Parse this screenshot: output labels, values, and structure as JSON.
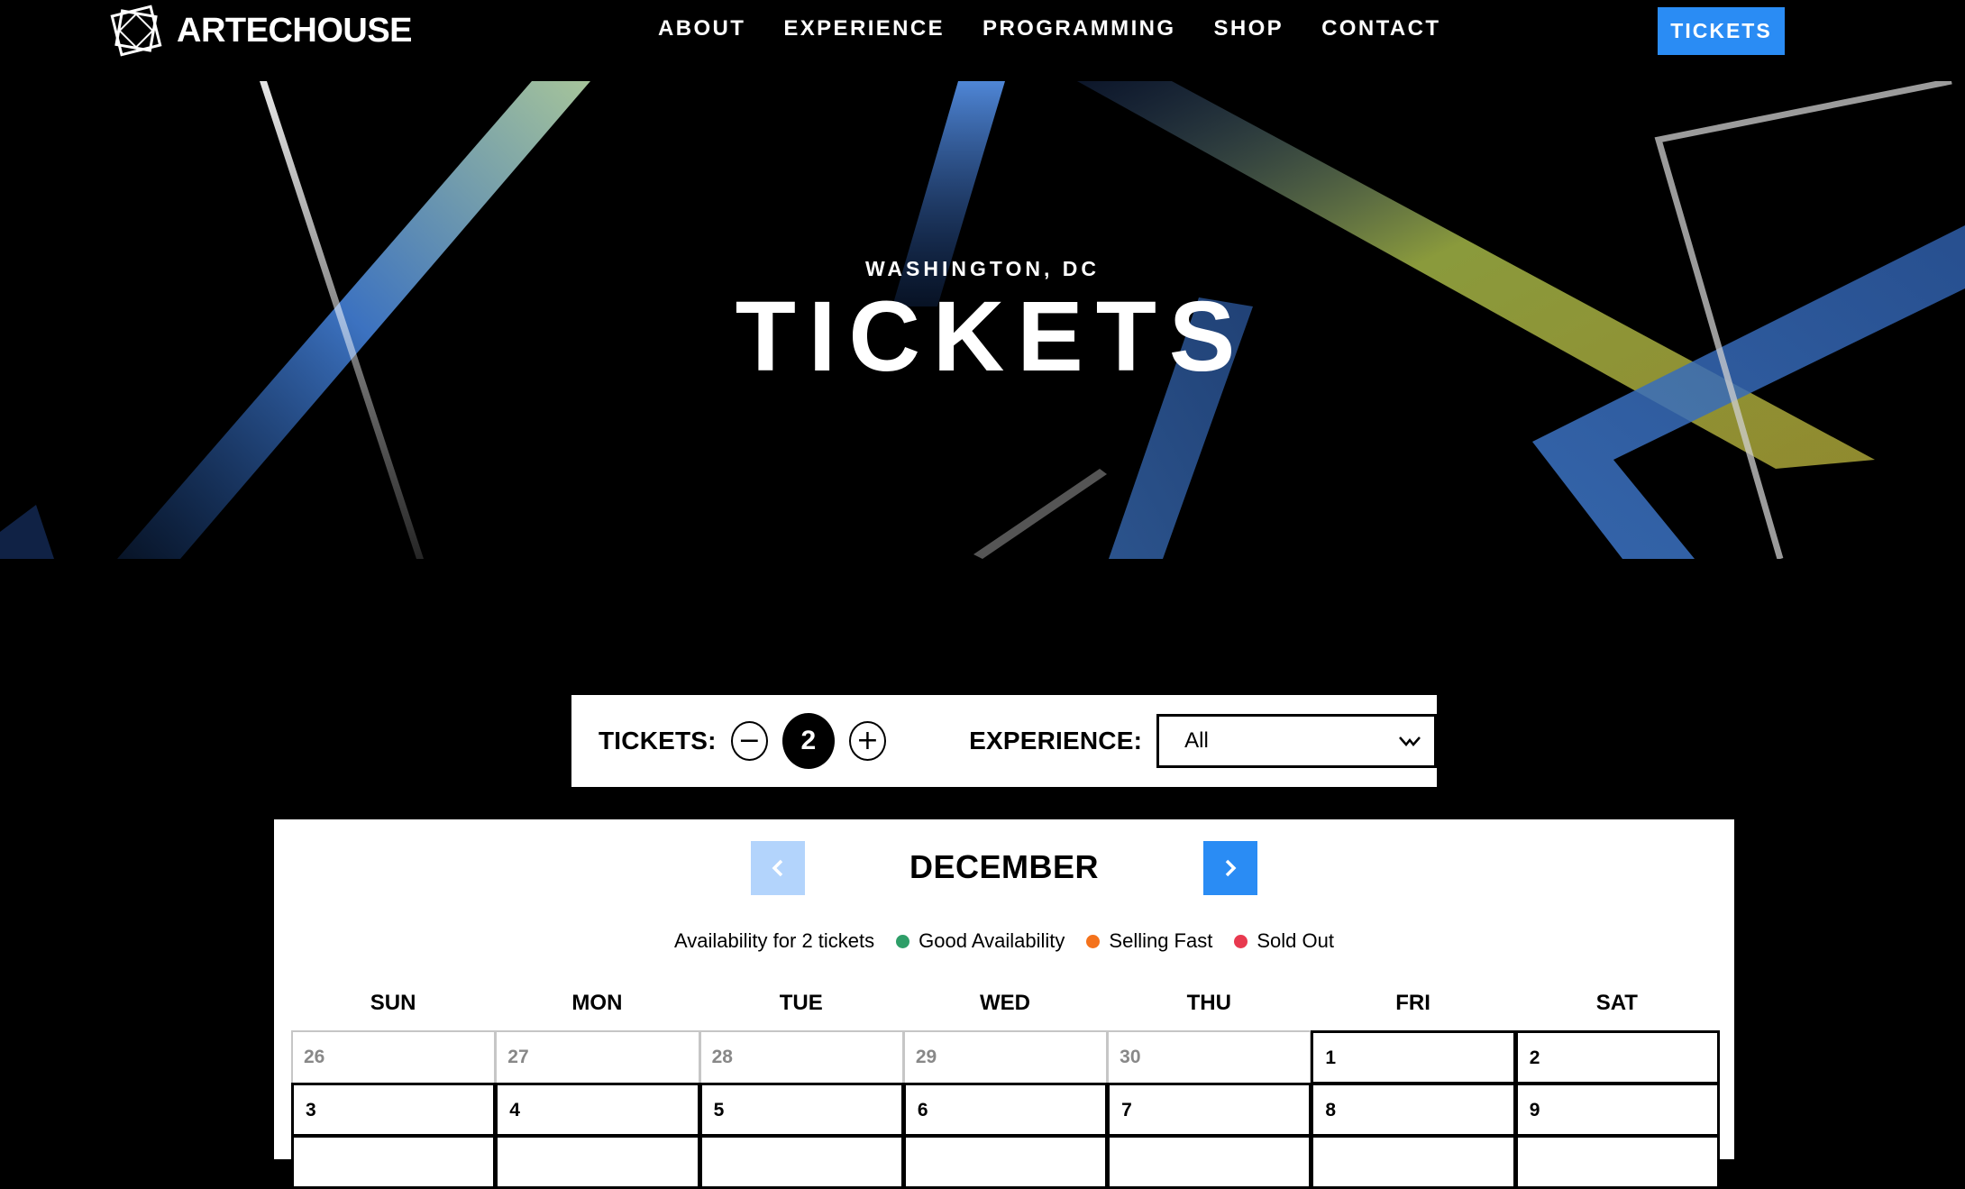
{
  "header": {
    "logo_text": "ARTECHOUSE",
    "nav": [
      "ABOUT",
      "EXPERIENCE",
      "PROGRAMMING",
      "SHOP",
      "CONTACT"
    ],
    "tickets_button": "TICKETS"
  },
  "hero": {
    "subtitle": "WASHINGTON, DC",
    "title": "TICKETS"
  },
  "controls": {
    "tickets_label": "TICKETS:",
    "quantity": "2",
    "minus_icon": "−",
    "plus_icon": "+",
    "experience_label": "EXPERIENCE:",
    "experience_value": "All"
  },
  "calendar": {
    "month": "DECEMBER",
    "availability_text": "Availability for 2 tickets",
    "legend": [
      {
        "label": "Good Availability",
        "color": "#2e9e68"
      },
      {
        "label": "Selling Fast",
        "color": "#f4721c"
      },
      {
        "label": "Sold Out",
        "color": "#e8394f"
      }
    ],
    "weekdays": [
      "SUN",
      "MON",
      "TUE",
      "WED",
      "THU",
      "FRI",
      "SAT"
    ],
    "days": [
      {
        "n": "26",
        "active": false
      },
      {
        "n": "27",
        "active": false
      },
      {
        "n": "28",
        "active": false
      },
      {
        "n": "29",
        "active": false
      },
      {
        "n": "30",
        "active": false
      },
      {
        "n": "1",
        "active": true
      },
      {
        "n": "2",
        "active": true
      },
      {
        "n": "3",
        "active": true
      },
      {
        "n": "4",
        "active": true
      },
      {
        "n": "5",
        "active": true
      },
      {
        "n": "6",
        "active": true
      },
      {
        "n": "7",
        "active": true
      },
      {
        "n": "8",
        "active": true
      },
      {
        "n": "9",
        "active": true
      },
      {
        "n": "",
        "active": true
      },
      {
        "n": "",
        "active": true
      },
      {
        "n": "",
        "active": true
      },
      {
        "n": "",
        "active": true
      },
      {
        "n": "",
        "active": true
      },
      {
        "n": "",
        "active": true
      },
      {
        "n": "",
        "active": true
      }
    ]
  },
  "colors": {
    "accent": "#2a8cf4",
    "accent_light": "#b3d4fc"
  }
}
